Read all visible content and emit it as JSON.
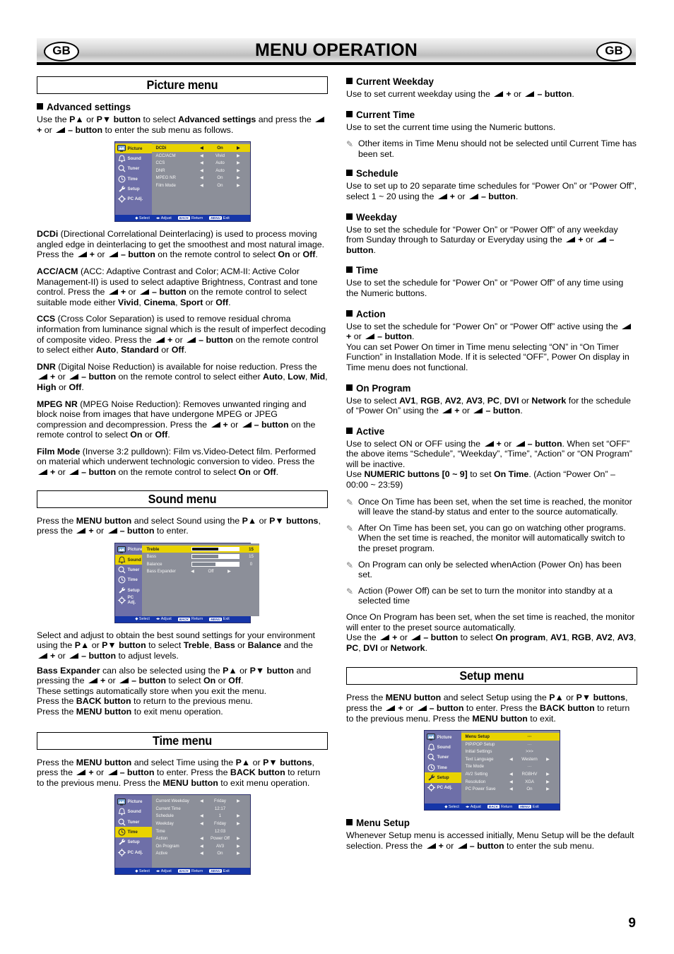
{
  "header": {
    "title": "MENU OPERATION",
    "badge_left": "GB",
    "badge_right": "GB"
  },
  "page_number": "9",
  "left_column": {
    "picture_menu": {
      "title": "Picture menu",
      "heading_advanced": "Advanced settings",
      "intro_1": "Use the ",
      "intro_2": "P▲",
      "intro_3": " or ",
      "intro_4": "P▼ button",
      "intro_5": " to select ",
      "intro_6": "Advanced settings",
      "intro_7": " and press the ",
      "intro_8": "+ or ",
      "intro_9": "– button",
      "intro_10": " to enter the sub menu as follows.",
      "paragraphs": [
        {
          "term": "DCDi",
          "body": " (Directional Correlational Deinterlacing) is used to process moving angled edge in deinterlacing to get the smoothest and most natural image. Press the ◀+ or ◀– button on the remote control to select On or Off."
        },
        {
          "term": "ACC/ACM",
          "body": " (ACC: Adaptive Contrast and Color; ACM-II: Active Color Management-II) is used to select adaptive Brightness, Contrast and tone control. Press the ◀+ or ◀– button on the remote control to select suitable mode either Vivid, Cinema, Sport or Off."
        },
        {
          "term": "CCS",
          "body": " (Cross Color Separation) is used to remove residual chroma information from luminance signal which is the result of imperfect decoding of composite video. Press the ◀+ or ◀– button on the remote control to select either Auto, Standard or Off."
        },
        {
          "term": "DNR",
          "body": " (Digital Noise Reduction) is available for noise reduction. Press the ◀+ or ◀– button on the remote control to select either Auto, Low, Mid, High or Off."
        },
        {
          "term": "MPEG NR",
          "body": " (MPEG Noise Reduction): Removes unwanted ringing and block noise from images that have undergone MPEG or JPEG compression and decompression. Press the ◀+ or ◀– button on the remote control to select On or Off."
        },
        {
          "term": "Film Mode",
          "body": " (Inverse 3:2 pulldown): Film vs.Video-Detect film. Performed on material which underwent technologic conversion to video. Press the ◀+ or ◀– button on the remote control to select On or Off."
        }
      ]
    },
    "sound_menu": {
      "title": "Sound menu",
      "intro": "Press the MENU button and select Sound using the P▲ or P▼ buttons, press the ◀+ or ◀– button to enter.",
      "body": "Select and adjust to obtain the best sound settings for your environment using the P▲ or P▼ button to select Treble, Bass or Balance and the ◀+ or ◀– button to adjust levels.",
      "body2": "Bass Expander can also be selected using the P▲ or P▼ button and pressing the ◀+ or ◀– button to select On or Off.",
      "body3": "These settings automatically store when you exit the menu.",
      "body4": "Press the BACK button to return to the previous menu.",
      "body5": "Press the MENU button to exit menu operation."
    },
    "time_menu": {
      "title": "Time menu",
      "intro": "Press the MENU button and select Time using the P▲ or P▼ buttons, press the ◀+ or ◀– button to enter. Press the BACK button to return to the previous menu. Press the MENU button to exit menu operation."
    }
  },
  "right_column": {
    "sections": [
      {
        "heading": "Current Weekday",
        "body": "Use to set current weekday using the ◀+ or ◀– button."
      },
      {
        "heading": "Current Time",
        "body": "Use to set the current time using the Numeric buttons.",
        "notes": [
          "Other items in Time Menu should not be selected until Current Time has been set."
        ]
      },
      {
        "heading": "Schedule",
        "body": "Use to set up to 20 separate time schedules for “Power On” or “Power Off”, select 1 ~ 20 using the ◀+ or ◀– button."
      },
      {
        "heading": "Weekday",
        "body": "Use to set the schedule for “Power On” or “Power Off” of any weekday from Sunday through to Saturday or Everyday using the ◀+ or ◀– button."
      },
      {
        "heading": "Time",
        "body": "Use to set the schedule for “Power On” or “Power Off” of any time using the Numeric buttons."
      },
      {
        "heading": "Action",
        "body": "Use to set the schedule for “Power On” or “Power Off” active using the ◀+ or ◀– button.",
        "body2": "You can set Power On timer in Time menu selecting “ON” in “On Timer Function” in Installation Mode. If it is selected “OFF”, Power On display in Time menu does not functional."
      },
      {
        "heading": "On Program",
        "body": "Use to select AV1, RGB, AV2, AV3, PC, DVI or Network for the schedule of “Power On” using the ◀+ or ◀– button."
      },
      {
        "heading": "Active",
        "body": "Use to select ON or OFF using the ◀+ or ◀– button. When set “OFF” the above items “Schedule”, “Weekday”, “Time”, “Action” or “ON Program” will be inactive.",
        "body2": "Use NUMERIC buttons [0 ~ 9] to set On Time. (Action “Power On” – 00:00 ~ 23:59)",
        "notes": [
          "Once On Time has been set, when the set time is reached, the monitor will leave the stand-by status and enter to the source automatically.",
          "After On Time has been set, you can go on watching other programs. When the set time is reached, the monitor will automatically switch to the preset program.",
          "On Program can only be selected whenAction (Power On) has been set.",
          "Action (Power Off) can be set to turn the monitor into standby at a selected time"
        ],
        "closing": "Once On Program has been set, when the set time is reached, the monitor will enter to the preset source automatically.",
        "closing2": "Use the ◀+ or ◀– button to select On program, AV1, RGB, AV2, AV3, PC, DVI or Network."
      }
    ],
    "setup_menu": {
      "title": "Setup menu",
      "intro": "Press the MENU button and select Setup using the P▲ or P▼ buttons, press the ◀+ or ◀– button to enter. Press the BACK button to return to the previous menu. Press the MENU button to exit.",
      "heading_menu_setup": "Menu Setup",
      "body_menu_setup": "Whenever Setup menu is accessed initially, Menu Setup will be the default selection. Press the ◀+ or ◀– button to enter the sub menu."
    }
  },
  "osd": {
    "sidebar": [
      {
        "label": "Picture",
        "icon": "monitor-icon"
      },
      {
        "label": "Sound",
        "icon": "bell-icon"
      },
      {
        "label": "Tuner",
        "icon": "magnifier-icon"
      },
      {
        "label": "Time",
        "icon": "clock-icon"
      },
      {
        "label": "Setup",
        "icon": "wrench-icon"
      },
      {
        "label": "PC Adj.",
        "icon": "gear-icon"
      }
    ],
    "footer": {
      "select": "Select",
      "adjust": "Adjust",
      "back_key": "BACK",
      "back_label": "Return",
      "menu_key": "MENU",
      "menu_label": "Exit"
    },
    "picture": {
      "selected_index": 0,
      "rows": [
        {
          "label": "DCDi",
          "value": "On"
        },
        {
          "label": "ACC/ACM",
          "value": "Vivid"
        },
        {
          "label": "CCS",
          "value": "Auto"
        },
        {
          "label": "DNR",
          "value": "Auto"
        },
        {
          "label": "MPEG NR",
          "value": "On"
        },
        {
          "label": "Film Mode",
          "value": "On"
        }
      ]
    },
    "sound": {
      "selected_index": 1,
      "rows": [
        {
          "label": "Treble",
          "type": "bar",
          "value": "15",
          "fill": 55
        },
        {
          "label": "Bass",
          "type": "bar",
          "value": "15",
          "fill": 55
        },
        {
          "label": "Balance",
          "type": "bar",
          "value": "0",
          "fill": 50
        },
        {
          "label": "Bass Expander",
          "type": "sel",
          "value": "Off"
        }
      ]
    },
    "time": {
      "selected_index": 3,
      "rows": [
        {
          "label": "Current Weekday",
          "value": "Friday",
          "arrows": true
        },
        {
          "label": "Current Time",
          "value": "12:17",
          "arrows": false
        },
        {
          "label": "Schedule",
          "value": "1",
          "arrows": true
        },
        {
          "label": "Weekday",
          "value": "Friday",
          "arrows": true
        },
        {
          "label": "Time",
          "value": "12:03",
          "arrows": false
        },
        {
          "label": "Action",
          "value": "Power Off",
          "arrows": true
        },
        {
          "label": "On Program",
          "value": "AV3",
          "arrows": true
        },
        {
          "label": "Active",
          "value": "On",
          "arrows": true
        }
      ]
    },
    "setup": {
      "selected_index": 4,
      "rows": [
        {
          "label": "Menu Setup",
          "value": "···",
          "arrows": false,
          "sel": true
        },
        {
          "label": "PIP/POP Setup",
          "value": "···",
          "arrows": false
        },
        {
          "label": "Initial Settings",
          "value": ">>>",
          "arrows": false
        },
        {
          "label": "Text Language",
          "value": "Western",
          "arrows": true
        },
        {
          "label": "Tile Mode",
          "value": "···",
          "arrows": false
        },
        {
          "label": "AV2 Setting",
          "value": "RGBHV",
          "arrows": true
        },
        {
          "label": "Resolution",
          "value": "XGA",
          "arrows": true
        },
        {
          "label": "PC Power Save",
          "value": "On",
          "arrows": true
        }
      ]
    }
  },
  "colors": {
    "osd_highlight": "#e9d300",
    "osd_sidebar": "#6e6fa8",
    "osd_body": "#8c8f99",
    "osd_footer": "#1636a8"
  }
}
